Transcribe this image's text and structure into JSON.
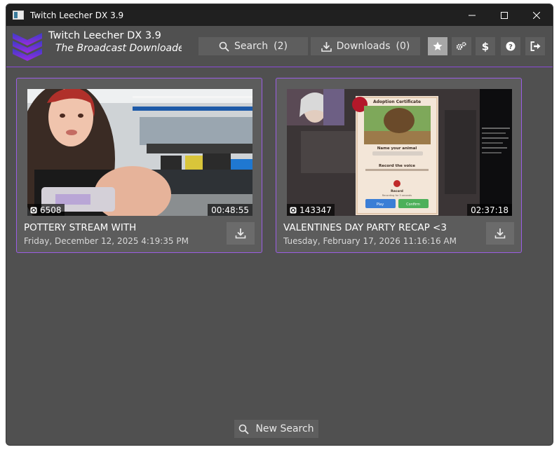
{
  "window": {
    "title": "Twitch Leecher DX 3.9"
  },
  "header": {
    "app_name": "Twitch Leecher DX 3.9",
    "subtitle": "The Broadcast Downloader",
    "nav": {
      "search_label": "Search",
      "search_count": "(2)",
      "downloads_label": "Downloads",
      "downloads_count": "(0)"
    },
    "icons": [
      "star-icon",
      "gears-icon",
      "dollar-icon",
      "help-icon",
      "logout-icon"
    ]
  },
  "videos": [
    {
      "views": "6508",
      "duration": "00:48:55",
      "title": "POTTERY STREAM WITH",
      "date": "Friday, December 12, 2025 4:19:35 PM"
    },
    {
      "views": "143347",
      "duration": "02:37:18",
      "title": "VALENTINES DAY PARTY RECAP <3",
      "date": "Tuesday, February 17, 2026 11:16:16 AM"
    }
  ],
  "thumbnail2_text": {
    "cert_title": "Adoption Certificate",
    "name_label": "Name your animal",
    "record_label": "Record the voice",
    "record_btn": "Record",
    "record_sub": "Recording for 3 seconds",
    "play_btn": "Play",
    "confirm_btn": "Confirm"
  },
  "footer": {
    "new_search_label": "New Search"
  },
  "colors": {
    "accent": "#9b5de5",
    "background": "#505050",
    "titlebar": "#202020"
  }
}
